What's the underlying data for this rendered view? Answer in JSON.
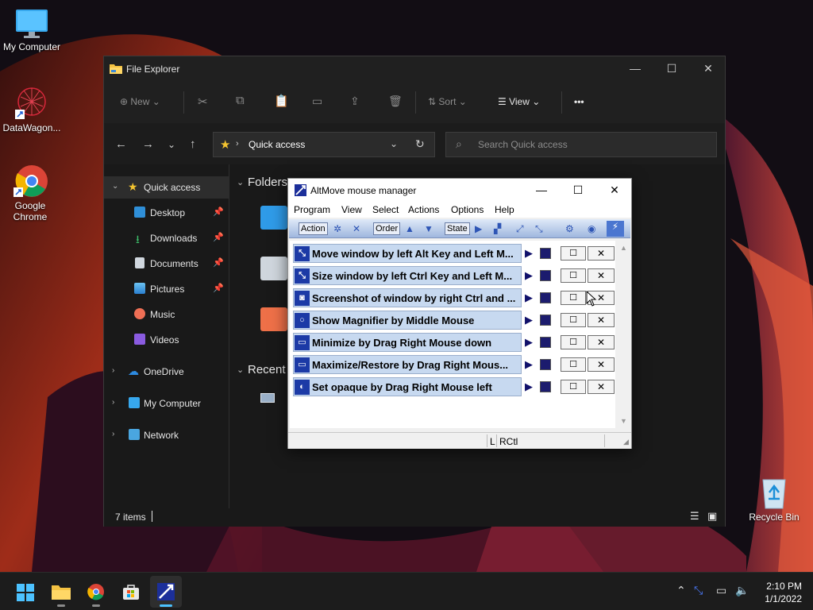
{
  "desktop": {
    "icons": [
      {
        "label": "My Computer",
        "icon": "monitor-icon"
      },
      {
        "label": "DataWagon...",
        "icon": "datawagon-icon"
      },
      {
        "label": "Google Chrome",
        "icon": "chrome-icon"
      },
      {
        "label": "Recycle Bin",
        "icon": "recycle-bin-icon"
      }
    ]
  },
  "explorer": {
    "title": "File Explorer",
    "toolbar": {
      "new": "New",
      "sort": "Sort",
      "view": "View",
      "more": "•••"
    },
    "address": "Quick access",
    "search_placeholder": "Search Quick access",
    "sidebar": [
      {
        "label": "Quick access",
        "pinned": false
      },
      {
        "label": "Desktop",
        "pinned": true
      },
      {
        "label": "Downloads",
        "pinned": true
      },
      {
        "label": "Documents",
        "pinned": true
      },
      {
        "label": "Pictures",
        "pinned": true
      },
      {
        "label": "Music",
        "pinned": false
      },
      {
        "label": "Videos",
        "pinned": false
      },
      {
        "label": "OneDrive",
        "pinned": false
      },
      {
        "label": "My Computer",
        "pinned": false
      },
      {
        "label": "Network",
        "pinned": false
      }
    ],
    "sections": {
      "folders": "Folders",
      "recent": "Recent"
    },
    "status": "7 items"
  },
  "altmove": {
    "title": "AltMove mouse manager",
    "menu": [
      "Program",
      "View",
      "Select",
      "Actions",
      "Options",
      "Help"
    ],
    "toolbar": {
      "action": "Action",
      "order": "Order",
      "state": "State"
    },
    "rows": [
      {
        "label": "Move window by left Alt Key and Left M..."
      },
      {
        "label": "Size window by left Ctrl Key and Left M..."
      },
      {
        "label": "Screenshot of window by right Ctrl and ..."
      },
      {
        "label": "Show Magnifier by Middle Mouse"
      },
      {
        "label": "Minimize by Drag Right Mouse down"
      },
      {
        "label": "Maximize/Restore by Drag Right Mous..."
      },
      {
        "label": "Set opaque by Drag Right Mouse left"
      }
    ],
    "status": {
      "l": "L",
      "key": "RCtl"
    }
  },
  "taskbar": {
    "time": "2:10 PM",
    "date": "1/1/2022"
  },
  "colors": {
    "accent": "#0067c0",
    "altmove_row": "#c7d9f0",
    "explorer_bg": "#191919"
  }
}
